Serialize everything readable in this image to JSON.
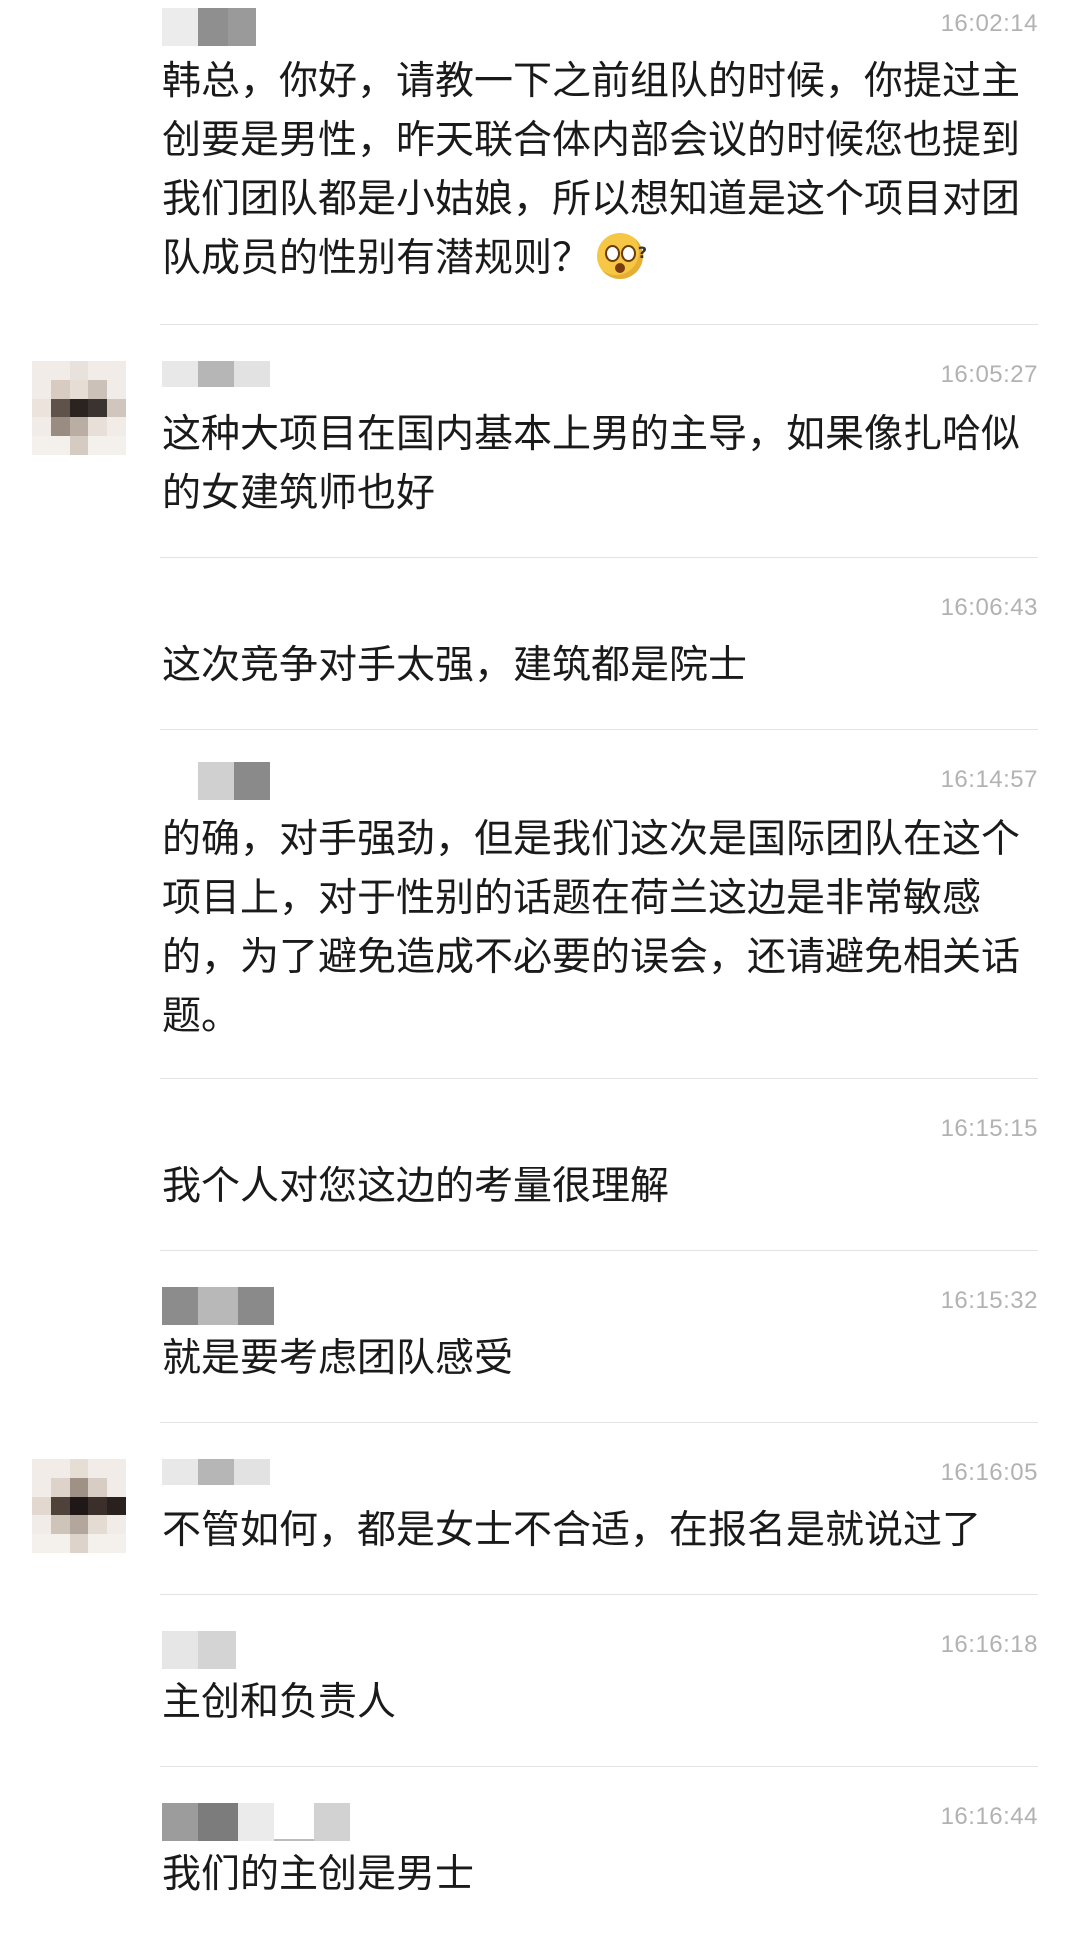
{
  "messages": [
    {
      "time": "16:02:14",
      "text": "韩总，你好，请教一下之前组队的时候，你提过主创要是男性，昨天联合体内部会议的时候您也提到我们团队都是小姑娘，所以想知道是这个项目对团队成员的性别有潜规则？",
      "emoji": "thinking-face-with-question-icon"
    },
    {
      "time": "16:05:27",
      "text": "这种大项目在国内基本上男的主导，如果像扎哈似的女建筑师也好"
    },
    {
      "time": "16:06:43",
      "text": "这次竞争对手太强，建筑都是院士"
    },
    {
      "time": "16:14:57",
      "text": "的确，对手强劲，但是我们这次是国际团队在这个项目上，对于性别的话题在荷兰这边是非常敏感的，为了避免造成不必要的误会，还请避免相关话题。"
    },
    {
      "time": "16:15:15",
      "text": "我个人对您这边的考量很理解"
    },
    {
      "time": "16:15:32",
      "text": "就是要考虑团队感受"
    },
    {
      "time": "16:16:05",
      "text": "不管如何，都是女士不合适，在报名是就说过了"
    },
    {
      "time": "16:16:18",
      "text": "主创和负责人"
    },
    {
      "time": "16:16:44",
      "text": "我们的主创是男士"
    }
  ],
  "colors": {
    "text": "#1a1a1a",
    "time": "#b2b2b2",
    "divider": "#e3e3e3",
    "blur_light": "#e4e4e4",
    "blur_mid": "#b9b9b9",
    "blur_dark": "#8c8c8c"
  }
}
